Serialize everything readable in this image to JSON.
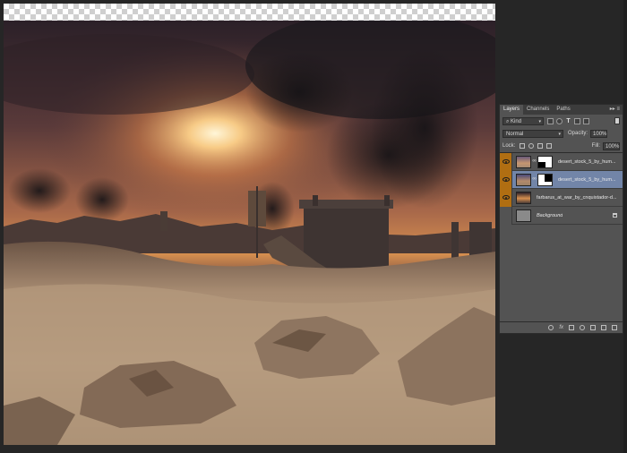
{
  "layers_panel": {
    "tabs": [
      "Layers",
      "Channels",
      "Paths"
    ],
    "filter_kind": "Kind",
    "blend_mode": "Normal",
    "opacity_label": "Opacity:",
    "opacity_value": "100%",
    "lock_label": "Lock:",
    "fill_label": "Fill:",
    "fill_value": "100%",
    "layers": [
      {
        "name": "desert_stock_5_by_hum...",
        "visible": true,
        "selected": false,
        "has_mask": true
      },
      {
        "name": "desert_stock_5_by_hum...",
        "visible": true,
        "selected": true,
        "has_mask": true
      },
      {
        "name": "farbarus_at_war_by_cnquistador-d...",
        "visible": true,
        "selected": false,
        "has_mask": false
      },
      {
        "name": "Background",
        "visible": false,
        "selected": false,
        "has_mask": false,
        "locked": true
      }
    ],
    "footer_fx": "fx"
  },
  "colors": {
    "visibility_on": "#b06e12",
    "selected_row": "#7285a8",
    "panel_bg": "#535353",
    "workspace_bg": "#262626"
  }
}
